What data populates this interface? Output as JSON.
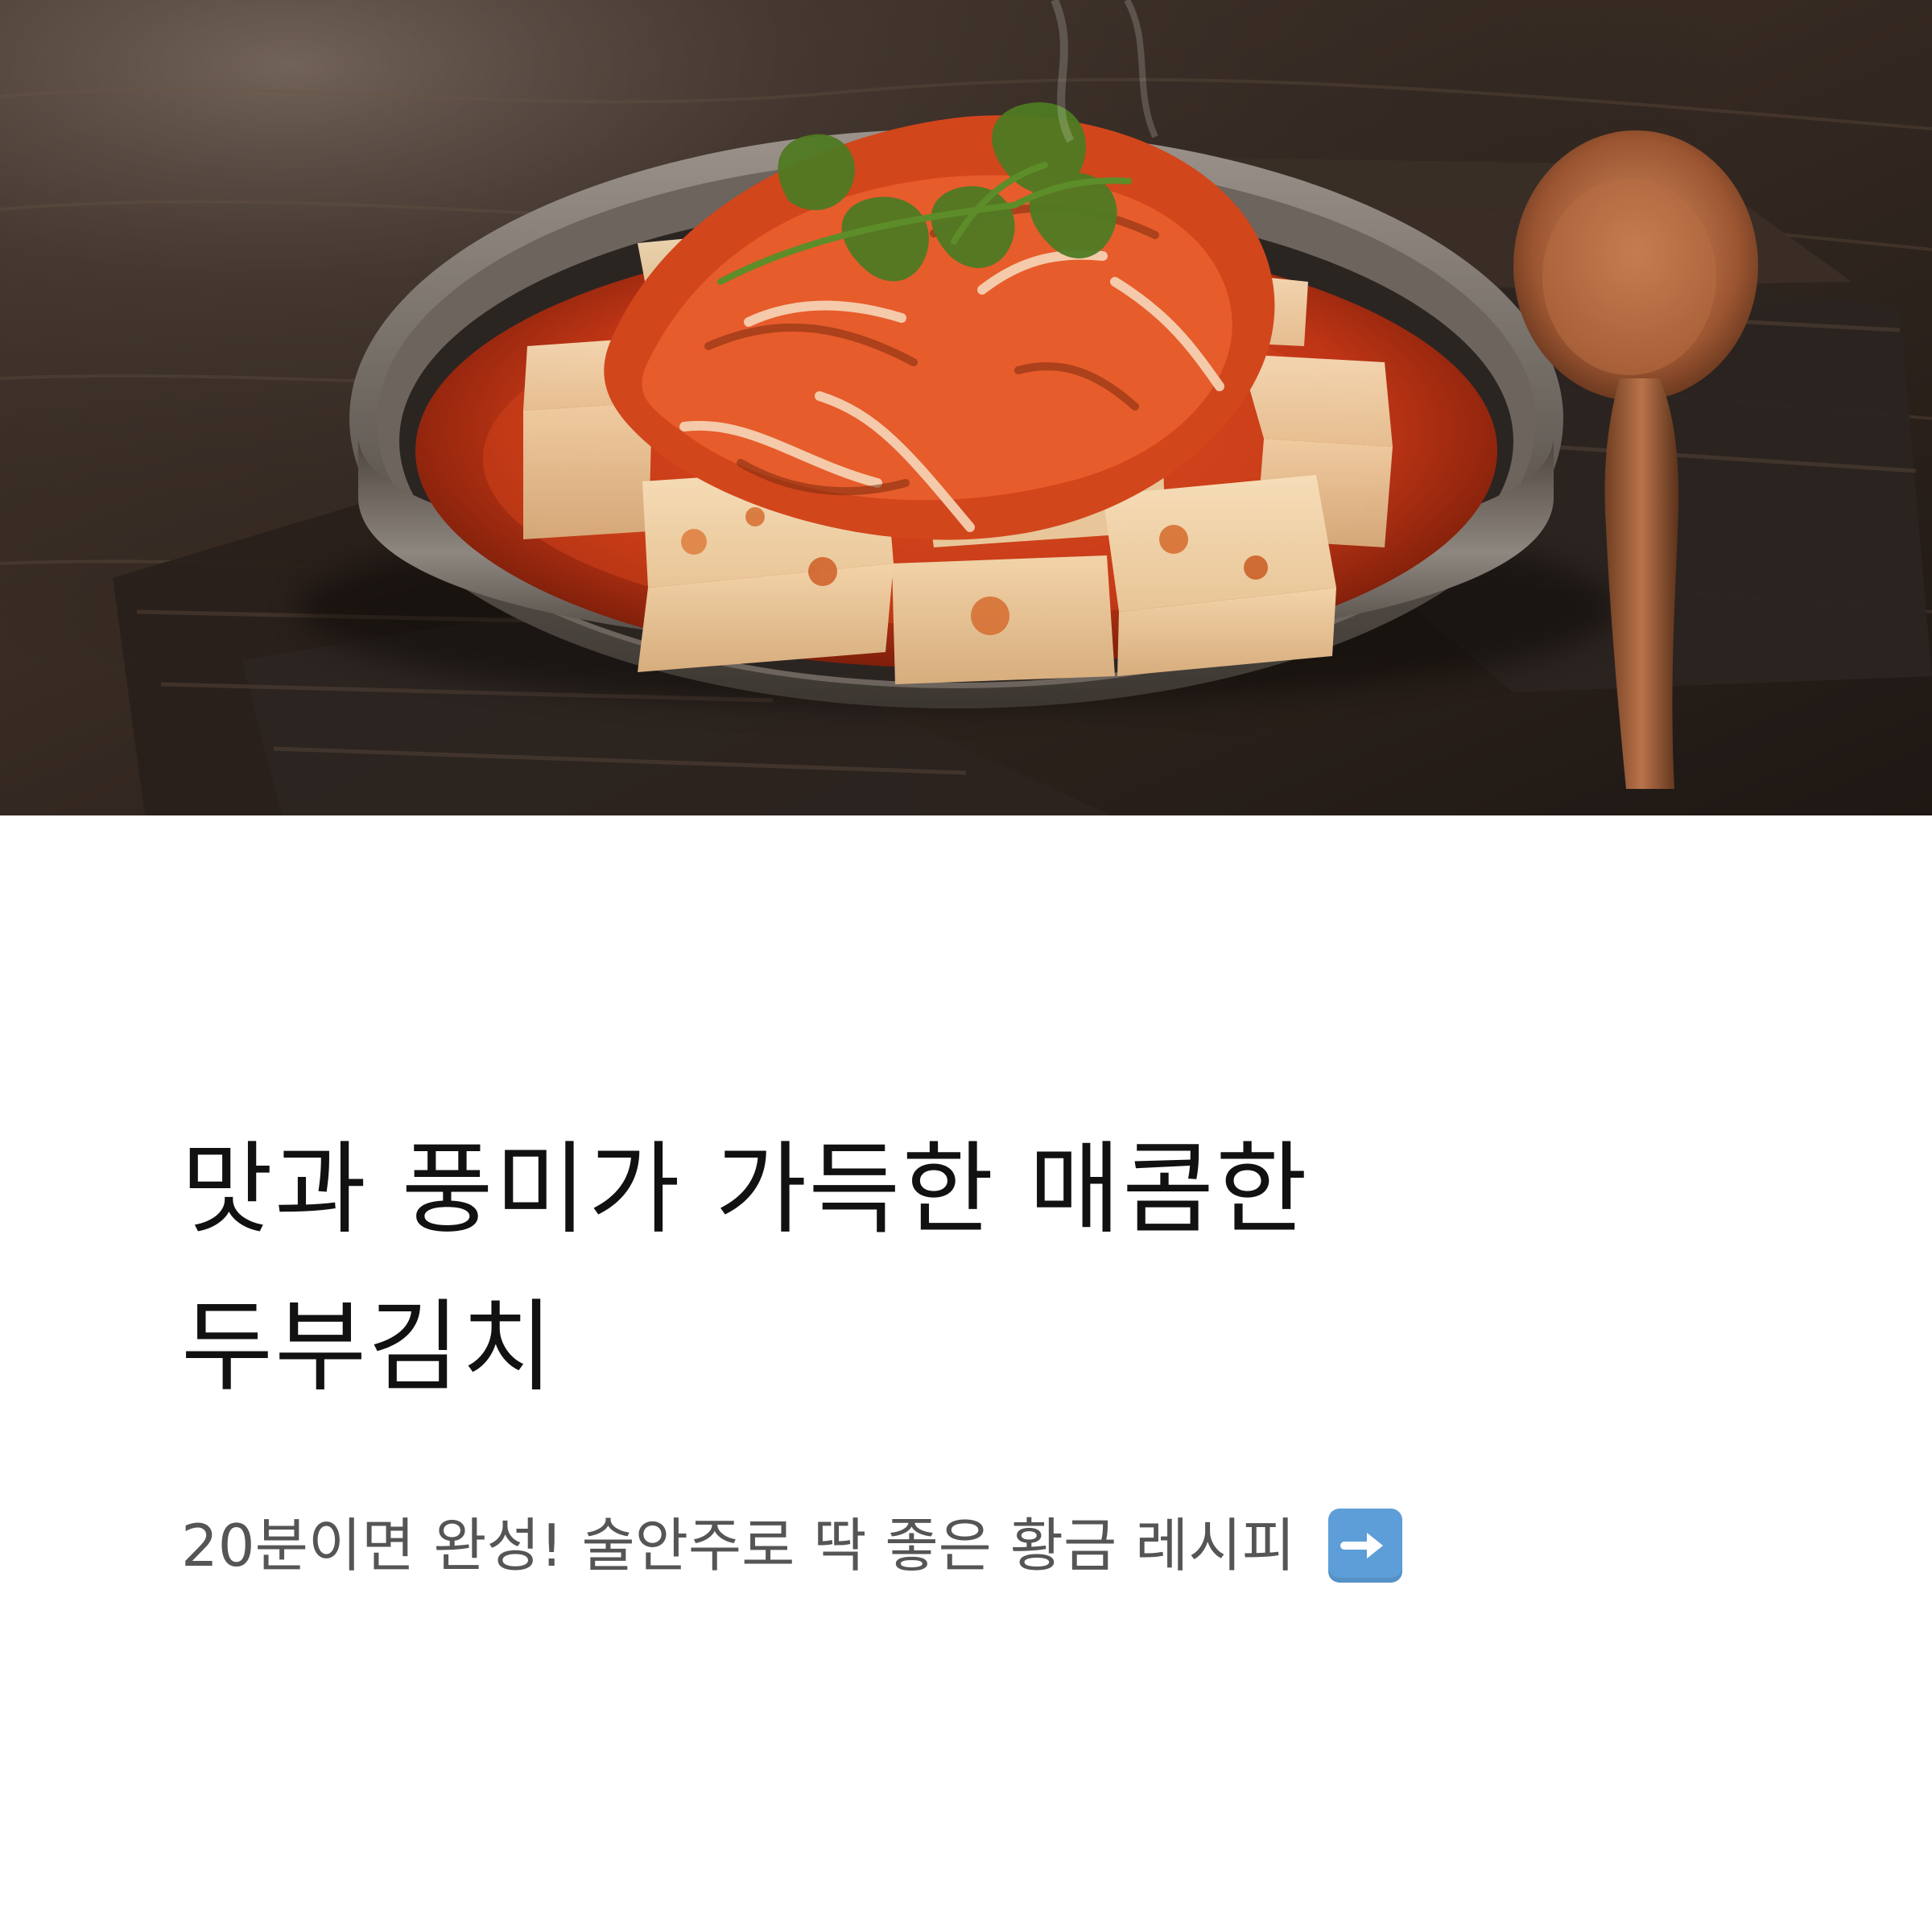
{
  "hero": {
    "image_name": "tofu-kimchi-photo"
  },
  "title": {
    "line1": "맛과 풍미가 가득한 매콤한",
    "line2": "두부김치"
  },
  "subtitle": {
    "text": "20분이면 완성! 술안주로 딱 좋은 황금 레시피",
    "icon": "arrow-right-icon"
  }
}
